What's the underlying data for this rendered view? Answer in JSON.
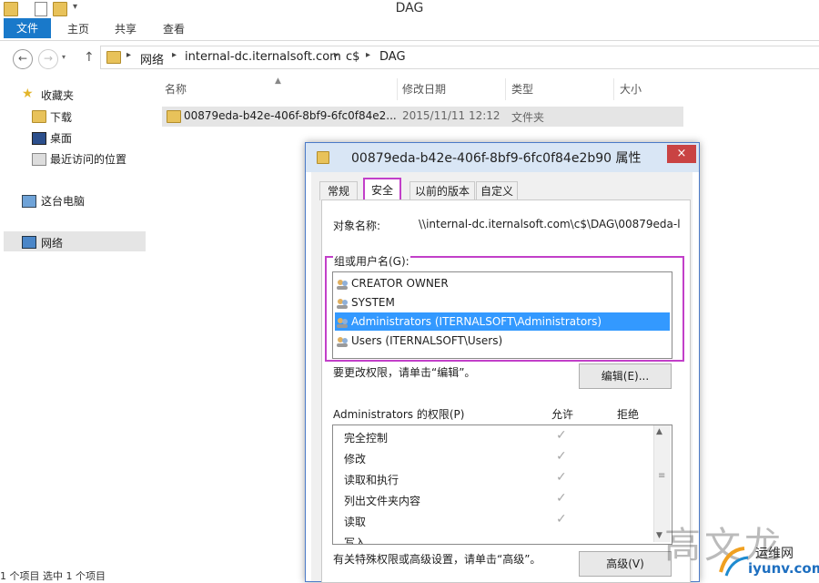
{
  "window": {
    "title": "DAG"
  },
  "ribbon": {
    "tabs": [
      "文件",
      "主页",
      "共享",
      "查看"
    ]
  },
  "address": {
    "crumbs": [
      "网络",
      "internal-dc.iternalsoft.com",
      "c$",
      "DAG"
    ]
  },
  "sidebar": {
    "favorites": {
      "label": "收藏夹",
      "items": [
        "下载",
        "桌面",
        "最近访问的位置"
      ]
    },
    "this_pc": "这台电脑",
    "network": "网络"
  },
  "filelist": {
    "columns": [
      "名称",
      "修改日期",
      "类型",
      "大小"
    ],
    "rows": [
      {
        "name": "00879eda-b42e-406f-8bf9-6fc0f84e2...",
        "date": "2015/11/11 12:12",
        "type": "文件夹",
        "size": ""
      }
    ]
  },
  "status": {
    "text": "1 个项目    选中 1 个项目"
  },
  "dialog": {
    "title": "00879eda-b42e-406f-8bf9-6fc0f84e2b90 属性",
    "close_icon": "×",
    "tabs": [
      "常规",
      "安全",
      "以前的版本",
      "自定义"
    ],
    "active_tab": "安全",
    "object_label": "对象名称:",
    "object_value": "\\\\internal-dc.iternalsoft.com\\c$\\DAG\\00879eda-l",
    "groups_label": "组或用户名(G):",
    "groups": [
      "CREATOR OWNER",
      "SYSTEM",
      "Administrators (ITERNALSOFT\\Administrators)",
      "Users (ITERNALSOFT\\Users)"
    ],
    "selected_group": "Administrators (ITERNALSOFT\\Administrators)",
    "change_hint": "要更改权限，请单击“编辑”。",
    "edit_button": "编辑(E)...",
    "perm_label": "Administrators 的权限(P)",
    "allow_label": "允许",
    "deny_label": "拒绝",
    "permissions": [
      {
        "name": "完全控制",
        "allow": true
      },
      {
        "name": "修改",
        "allow": true
      },
      {
        "name": "读取和执行",
        "allow": true
      },
      {
        "name": "列出文件夹内容",
        "allow": true
      },
      {
        "name": "读取",
        "allow": true
      },
      {
        "name": "写入",
        "allow": false
      }
    ],
    "advanced_hint": "有关特殊权限或高级设置，请单击“高级”。",
    "advanced_button": "高级(V)",
    "check_glyph": "✓"
  },
  "watermark": {
    "text": "高文龙",
    "logo_cn": "运维网",
    "logo_url": "iyunv.com"
  },
  "colors": {
    "accent": "#1979ca",
    "selection": "#3399ff",
    "highlight_box": "#c23fc9",
    "close": "#c94343"
  }
}
